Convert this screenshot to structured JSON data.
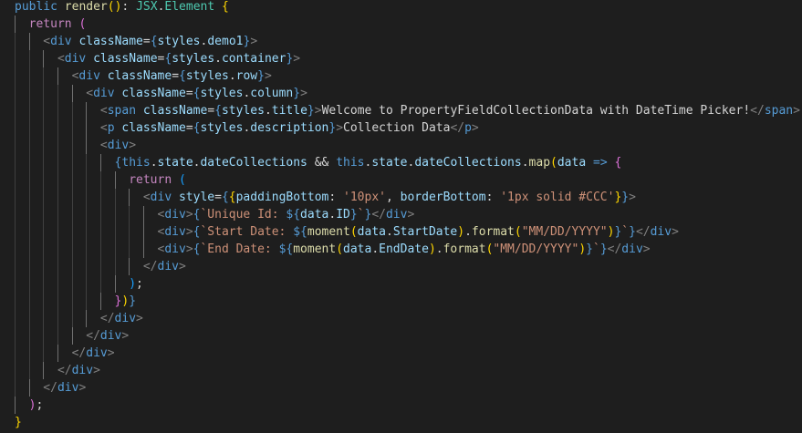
{
  "editor": {
    "language": "tsx",
    "lines": [
      [
        {
          "t": "public",
          "c": "kw"
        },
        {
          "t": " "
        },
        {
          "t": "render",
          "c": "fn"
        },
        {
          "t": "(",
          "c": "brk"
        },
        {
          "t": ")",
          "c": "brk"
        },
        {
          "t": ": "
        },
        {
          "t": "JSX",
          "c": "type"
        },
        {
          "t": "."
        },
        {
          "t": "Element",
          "c": "type"
        },
        {
          "t": " "
        },
        {
          "t": "{",
          "c": "brk"
        }
      ],
      [
        {
          "t": "return",
          "c": "ctl"
        },
        {
          "t": " "
        },
        {
          "t": "(",
          "c": "brk2"
        }
      ],
      [
        {
          "t": "<",
          "c": "punc"
        },
        {
          "t": "div",
          "c": "tag"
        },
        {
          "t": " "
        },
        {
          "t": "className",
          "c": "var"
        },
        {
          "t": "="
        },
        {
          "t": "{",
          "c": "kw"
        },
        {
          "t": "styles",
          "c": "var"
        },
        {
          "t": "."
        },
        {
          "t": "demo1",
          "c": "var"
        },
        {
          "t": "}",
          "c": "kw"
        },
        {
          "t": ">",
          "c": "punc"
        }
      ],
      [
        {
          "t": "<",
          "c": "punc"
        },
        {
          "t": "div",
          "c": "tag"
        },
        {
          "t": " "
        },
        {
          "t": "className",
          "c": "var"
        },
        {
          "t": "="
        },
        {
          "t": "{",
          "c": "kw"
        },
        {
          "t": "styles",
          "c": "var"
        },
        {
          "t": "."
        },
        {
          "t": "container",
          "c": "var"
        },
        {
          "t": "}",
          "c": "kw"
        },
        {
          "t": ">",
          "c": "punc"
        }
      ],
      [
        {
          "t": "<",
          "c": "punc"
        },
        {
          "t": "div",
          "c": "tag"
        },
        {
          "t": " "
        },
        {
          "t": "className",
          "c": "var"
        },
        {
          "t": "="
        },
        {
          "t": "{",
          "c": "kw"
        },
        {
          "t": "styles",
          "c": "var"
        },
        {
          "t": "."
        },
        {
          "t": "row",
          "c": "var"
        },
        {
          "t": "}",
          "c": "kw"
        },
        {
          "t": ">",
          "c": "punc"
        }
      ],
      [
        {
          "t": "<",
          "c": "punc"
        },
        {
          "t": "div",
          "c": "tag"
        },
        {
          "t": " "
        },
        {
          "t": "className",
          "c": "var"
        },
        {
          "t": "="
        },
        {
          "t": "{",
          "c": "kw"
        },
        {
          "t": "styles",
          "c": "var"
        },
        {
          "t": "."
        },
        {
          "t": "column",
          "c": "var"
        },
        {
          "t": "}",
          "c": "kw"
        },
        {
          "t": ">",
          "c": "punc"
        }
      ],
      [
        {
          "t": "<",
          "c": "punc"
        },
        {
          "t": "span",
          "c": "tag"
        },
        {
          "t": " "
        },
        {
          "t": "className",
          "c": "var"
        },
        {
          "t": "="
        },
        {
          "t": "{",
          "c": "kw"
        },
        {
          "t": "styles",
          "c": "var"
        },
        {
          "t": "."
        },
        {
          "t": "title",
          "c": "var"
        },
        {
          "t": "}",
          "c": "kw"
        },
        {
          "t": ">",
          "c": "punc"
        },
        {
          "t": "Welcome to PropertyFieldCollectionData with DateTime Picker!"
        },
        {
          "t": "</",
          "c": "punc"
        },
        {
          "t": "span",
          "c": "tag"
        },
        {
          "t": ">",
          "c": "punc"
        }
      ],
      [
        {
          "t": "<",
          "c": "punc"
        },
        {
          "t": "p",
          "c": "tag"
        },
        {
          "t": " "
        },
        {
          "t": "className",
          "c": "var"
        },
        {
          "t": "="
        },
        {
          "t": "{",
          "c": "kw"
        },
        {
          "t": "styles",
          "c": "var"
        },
        {
          "t": "."
        },
        {
          "t": "description",
          "c": "var"
        },
        {
          "t": "}",
          "c": "kw"
        },
        {
          "t": ">",
          "c": "punc"
        },
        {
          "t": "Collection Data"
        },
        {
          "t": "</",
          "c": "punc"
        },
        {
          "t": "p",
          "c": "tag"
        },
        {
          "t": ">",
          "c": "punc"
        }
      ],
      [
        {
          "t": "<",
          "c": "punc"
        },
        {
          "t": "div",
          "c": "tag"
        },
        {
          "t": ">",
          "c": "punc"
        }
      ],
      [
        {
          "t": "{",
          "c": "kw"
        },
        {
          "t": "this",
          "c": "kw"
        },
        {
          "t": "."
        },
        {
          "t": "state",
          "c": "var"
        },
        {
          "t": "."
        },
        {
          "t": "dateCollections",
          "c": "var"
        },
        {
          "t": " && "
        },
        {
          "t": "this",
          "c": "kw"
        },
        {
          "t": "."
        },
        {
          "t": "state",
          "c": "var"
        },
        {
          "t": "."
        },
        {
          "t": "dateCollections",
          "c": "var"
        },
        {
          "t": "."
        },
        {
          "t": "map",
          "c": "fn"
        },
        {
          "t": "(",
          "c": "brk"
        },
        {
          "t": "data",
          "c": "var"
        },
        {
          "t": " "
        },
        {
          "t": "=>",
          "c": "kw"
        },
        {
          "t": " "
        },
        {
          "t": "{",
          "c": "brk2"
        }
      ],
      [
        {
          "t": "return",
          "c": "ctl"
        },
        {
          "t": " "
        },
        {
          "t": "(",
          "c": "brk3"
        }
      ],
      [
        {
          "t": "<",
          "c": "punc"
        },
        {
          "t": "div",
          "c": "tag"
        },
        {
          "t": " "
        },
        {
          "t": "style",
          "c": "var"
        },
        {
          "t": "="
        },
        {
          "t": "{",
          "c": "kw"
        },
        {
          "t": "{",
          "c": "brk"
        },
        {
          "t": "paddingBottom",
          "c": "var"
        },
        {
          "t": ": "
        },
        {
          "t": "'10px'",
          "c": "str"
        },
        {
          "t": ", "
        },
        {
          "t": "borderBottom",
          "c": "var"
        },
        {
          "t": ": "
        },
        {
          "t": "'1px solid #CCC'",
          "c": "str"
        },
        {
          "t": "}",
          "c": "brk"
        },
        {
          "t": "}",
          "c": "kw"
        },
        {
          "t": ">",
          "c": "punc"
        }
      ],
      [
        {
          "t": "<",
          "c": "punc"
        },
        {
          "t": "div",
          "c": "tag"
        },
        {
          "t": ">",
          "c": "punc"
        },
        {
          "t": "{",
          "c": "kw"
        },
        {
          "t": "`Unique Id: ",
          "c": "str"
        },
        {
          "t": "${",
          "c": "kw"
        },
        {
          "t": "data",
          "c": "var"
        },
        {
          "t": "."
        },
        {
          "t": "ID",
          "c": "var"
        },
        {
          "t": "}",
          "c": "kw"
        },
        {
          "t": "`",
          "c": "str"
        },
        {
          "t": "}",
          "c": "kw"
        },
        {
          "t": "</",
          "c": "punc"
        },
        {
          "t": "div",
          "c": "tag"
        },
        {
          "t": ">",
          "c": "punc"
        }
      ],
      [
        {
          "t": "<",
          "c": "punc"
        },
        {
          "t": "div",
          "c": "tag"
        },
        {
          "t": ">",
          "c": "punc"
        },
        {
          "t": "{",
          "c": "kw"
        },
        {
          "t": "`Start Date: ",
          "c": "str"
        },
        {
          "t": "${",
          "c": "kw"
        },
        {
          "t": "moment",
          "c": "fn"
        },
        {
          "t": "(",
          "c": "brk"
        },
        {
          "t": "data",
          "c": "var"
        },
        {
          "t": "."
        },
        {
          "t": "StartDate",
          "c": "var"
        },
        {
          "t": ")",
          "c": "brk"
        },
        {
          "t": "."
        },
        {
          "t": "format",
          "c": "fn"
        },
        {
          "t": "(",
          "c": "brk"
        },
        {
          "t": "\"MM/DD/YYYY\"",
          "c": "str"
        },
        {
          "t": ")",
          "c": "brk"
        },
        {
          "t": "}",
          "c": "kw"
        },
        {
          "t": "`",
          "c": "str"
        },
        {
          "t": "}",
          "c": "kw"
        },
        {
          "t": "</",
          "c": "punc"
        },
        {
          "t": "div",
          "c": "tag"
        },
        {
          "t": ">",
          "c": "punc"
        }
      ],
      [
        {
          "t": "<",
          "c": "punc"
        },
        {
          "t": "div",
          "c": "tag"
        },
        {
          "t": ">",
          "c": "punc"
        },
        {
          "t": "{",
          "c": "kw"
        },
        {
          "t": "`End Date: ",
          "c": "str"
        },
        {
          "t": "${",
          "c": "kw"
        },
        {
          "t": "moment",
          "c": "fn"
        },
        {
          "t": "(",
          "c": "brk"
        },
        {
          "t": "data",
          "c": "var"
        },
        {
          "t": "."
        },
        {
          "t": "EndDate",
          "c": "var"
        },
        {
          "t": ")",
          "c": "brk"
        },
        {
          "t": "."
        },
        {
          "t": "format",
          "c": "fn"
        },
        {
          "t": "(",
          "c": "brk"
        },
        {
          "t": "\"MM/DD/YYYY\"",
          "c": "str"
        },
        {
          "t": ")",
          "c": "brk"
        },
        {
          "t": "}",
          "c": "kw"
        },
        {
          "t": "`",
          "c": "str"
        },
        {
          "t": "}",
          "c": "kw"
        },
        {
          "t": "</",
          "c": "punc"
        },
        {
          "t": "div",
          "c": "tag"
        },
        {
          "t": ">",
          "c": "punc"
        }
      ],
      [
        {
          "t": "</",
          "c": "punc"
        },
        {
          "t": "div",
          "c": "tag"
        },
        {
          "t": ">",
          "c": "punc"
        }
      ],
      [
        {
          "t": ")",
          "c": "brk3"
        },
        {
          "t": ";"
        }
      ],
      [
        {
          "t": "}",
          "c": "brk2"
        },
        {
          "t": ")",
          "c": "brk"
        },
        {
          "t": "}",
          "c": "kw"
        }
      ],
      [
        {
          "t": "</",
          "c": "punc"
        },
        {
          "t": "div",
          "c": "tag"
        },
        {
          "t": ">",
          "c": "punc"
        }
      ],
      [
        {
          "t": "</",
          "c": "punc"
        },
        {
          "t": "div",
          "c": "tag"
        },
        {
          "t": ">",
          "c": "punc"
        }
      ],
      [
        {
          "t": "</",
          "c": "punc"
        },
        {
          "t": "div",
          "c": "tag"
        },
        {
          "t": ">",
          "c": "punc"
        }
      ],
      [
        {
          "t": "</",
          "c": "punc"
        },
        {
          "t": "div",
          "c": "tag"
        },
        {
          "t": ">",
          "c": "punc"
        }
      ],
      [
        {
          "t": "</",
          "c": "punc"
        },
        {
          "t": "div",
          "c": "tag"
        },
        {
          "t": ">",
          "c": "punc"
        }
      ],
      [
        {
          "t": ")",
          "c": "brk2"
        },
        {
          "t": ";"
        }
      ],
      [
        {
          "t": "}",
          "c": "brk"
        }
      ]
    ]
  }
}
